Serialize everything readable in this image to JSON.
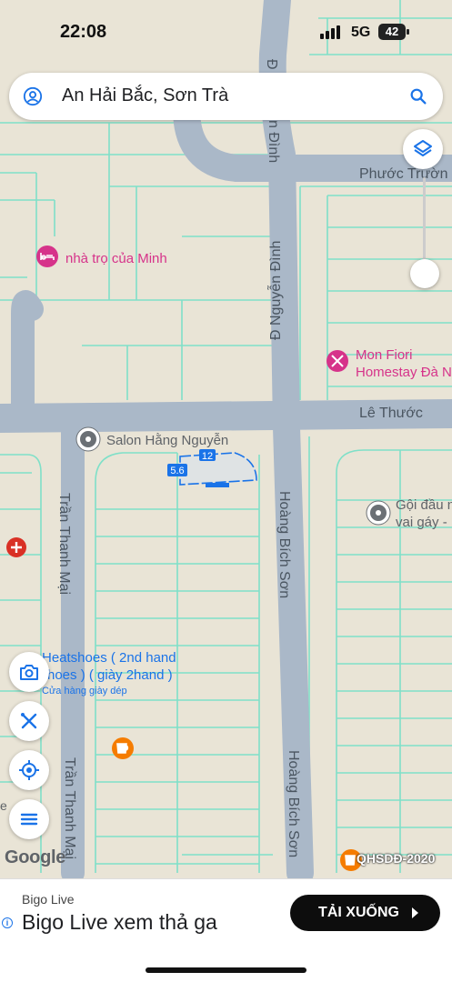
{
  "status_bar": {
    "time": "22:08",
    "network": "5G",
    "battery": "42"
  },
  "search": {
    "query": "An Hải Bắc, Sơn Trà"
  },
  "map": {
    "streets": [
      {
        "id": "phuoc-truong",
        "label": "Phước Trườn"
      },
      {
        "id": "nguyen-dinh",
        "label": "Đ Nguyễn Đình"
      },
      {
        "id": "nguyen-dinh-top",
        "label": "Đ"
      },
      {
        "id": "nguyen-dinh-mid",
        "label": "n Đình"
      },
      {
        "id": "le-thuoc",
        "label": "Lê Thước"
      },
      {
        "id": "hoang-bich-son-1",
        "label": "Hoàng Bích Sơn"
      },
      {
        "id": "hoang-bich-son-2",
        "label": "Hoàng Bích Sơn"
      },
      {
        "id": "tran-thanh-mai-1",
        "label": "Trần Thanh Mại"
      },
      {
        "id": "tran-thanh-mai-2",
        "label": "Trần Thanh Mại"
      }
    ],
    "places": [
      {
        "id": "nha-tro",
        "name": "nhà trọ của Minh",
        "color": "#d6338a"
      },
      {
        "id": "mon-fiori",
        "name": "Mon Fiori",
        "name2": "Homestay Đà N",
        "color": "#d6338a"
      },
      {
        "id": "salon",
        "name": "Salon Hằng Nguyễn",
        "color": "#5f6368"
      },
      {
        "id": "goi-dau",
        "name": "Gội đầu n",
        "name2": "vai gáy -",
        "color": "#5f6368"
      },
      {
        "id": "heatshoes",
        "name": "Heatshoes ( 2nd hand",
        "name2": "hoes ) ( giày 2hand )",
        "sub": "Cửa hàng giày dép",
        "color": "#1a73e8"
      }
    ],
    "measurements": {
      "width": "12",
      "depth": "5.6"
    },
    "logo": "Google",
    "overlay_label": "QHSDĐ-2020",
    "edge_letter": "e",
    "colors": {
      "land": "#e9e4d6",
      "road": "#aab8c8",
      "parcel": "#7fe0c8",
      "highlight": "#1a73e8"
    }
  },
  "controls": {
    "layers": "layers-icon",
    "camera": "add-photo-icon",
    "tools": "tools-icon",
    "locate": "my-location-icon",
    "menu": "menu-icon"
  },
  "ad": {
    "brand": "Bigo Live",
    "headline": "Bigo Live xem thả ga",
    "cta": "TẢI XUỐNG",
    "info": "i"
  }
}
